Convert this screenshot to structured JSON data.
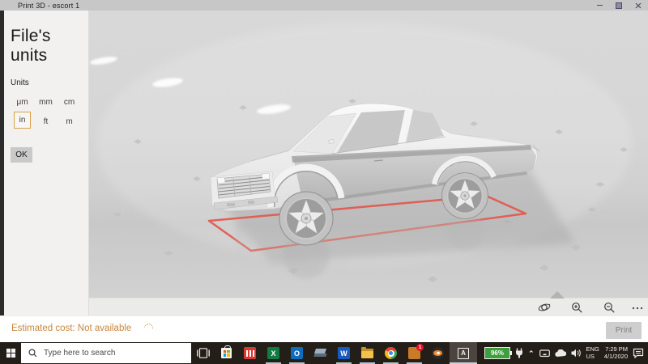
{
  "window": {
    "title": "Print 3D - escort 1",
    "controls": [
      "minimize",
      "maximize",
      "close"
    ]
  },
  "sidebar": {
    "heading": "File's units",
    "units_label": "Units",
    "unit_options": [
      {
        "label": "μm",
        "selected": false
      },
      {
        "label": "mm",
        "selected": false
      },
      {
        "label": "cm",
        "selected": false
      },
      {
        "label": "in",
        "selected": true
      },
      {
        "label": "ft",
        "selected": false
      },
      {
        "label": "m",
        "selected": false
      }
    ],
    "selected_unit": "in",
    "ok_label": "OK",
    "selected_border_color": "#d8a148"
  },
  "viewport": {
    "bed_outline_color": "#e25449",
    "toolbar_icons": [
      "orbit-view",
      "zoom-in",
      "zoom-out",
      "more"
    ]
  },
  "footer": {
    "estimated_cost": "Estimated cost: Not available",
    "print_label": "Print"
  },
  "taskbar": {
    "search_placeholder": "Type here to search",
    "apps": [
      {
        "name": "task-view",
        "running": false
      },
      {
        "name": "microsoft-store",
        "running": false
      },
      {
        "name": "red-stripes-app",
        "running": false
      },
      {
        "name": "excel",
        "glyph": "X",
        "running": true
      },
      {
        "name": "outlook",
        "glyph": "O",
        "running": true
      },
      {
        "name": "3d-builder",
        "running": false
      },
      {
        "name": "word",
        "glyph": "W",
        "running": true
      },
      {
        "name": "file-explorer",
        "running": true
      },
      {
        "name": "chrome",
        "running": true
      },
      {
        "name": "orange-app",
        "running": true,
        "badge": "1"
      },
      {
        "name": "blender",
        "running": false
      },
      {
        "name": "print-3d",
        "glyph": "A",
        "active": true
      }
    ],
    "tray": {
      "battery": "96%",
      "icons": [
        "power-plug",
        "hidden-icons-chevron",
        "device",
        "onedrive-cloud",
        "speaker"
      ],
      "language_line1": "ENG",
      "language_line2": "US",
      "time": "7:29 PM",
      "date": "4/1/2020"
    }
  }
}
